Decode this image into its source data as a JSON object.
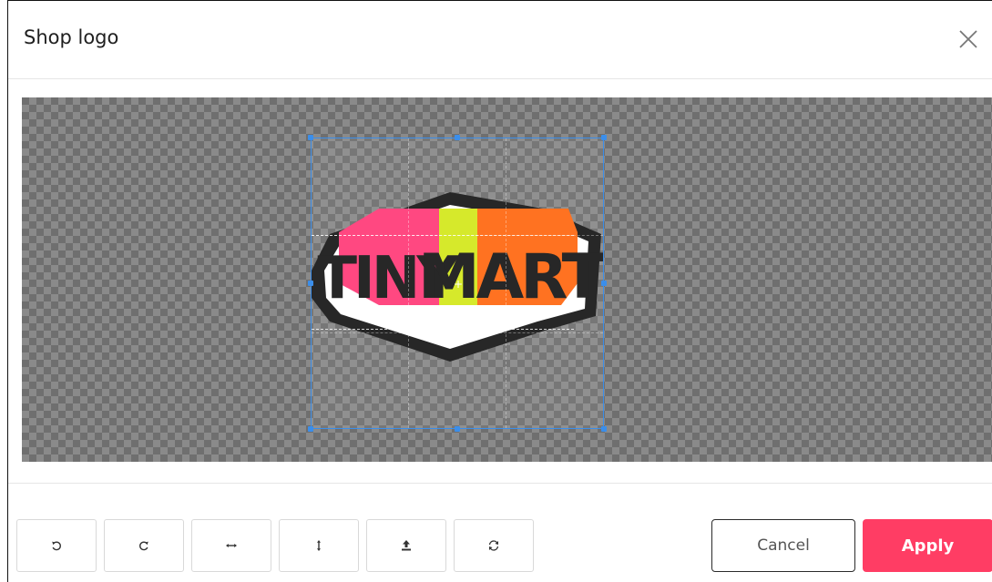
{
  "dialog": {
    "title": "Shop logo",
    "close_icon": "close-icon"
  },
  "image": {
    "logo_text_left": "TINY",
    "logo_text_right": "MART",
    "colors": {
      "pink": "#ff3d7a",
      "lime": "#d4e81e",
      "orange": "#ff6a14",
      "black": "#1a1a1a"
    }
  },
  "toolbar": {
    "tools": [
      {
        "name": "rotate-left-icon"
      },
      {
        "name": "rotate-right-icon"
      },
      {
        "name": "flip-horizontal-icon"
      },
      {
        "name": "flip-vertical-icon"
      },
      {
        "name": "upload-icon"
      },
      {
        "name": "reset-icon"
      }
    ],
    "cancel_label": "Cancel",
    "apply_label": "Apply",
    "accent_color": "#ff3d64"
  }
}
